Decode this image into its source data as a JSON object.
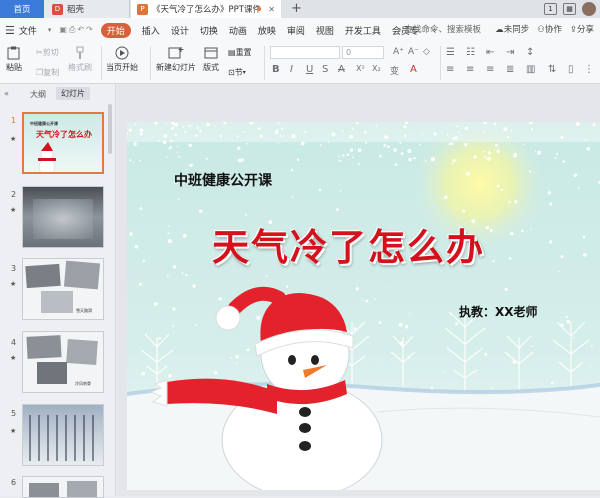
{
  "titlebar": {
    "home_tab": "首页",
    "tab2_label": "稻壳",
    "doc_tab_label": "《天气冷了怎么办》PPT课件",
    "add_tab": "+"
  },
  "menu": {
    "file": "文件",
    "items": [
      "开始",
      "插入",
      "设计",
      "切换",
      "动画",
      "放映",
      "审阅",
      "视图",
      "开发工具",
      "会员专"
    ],
    "search": "查找命令、搜索模板",
    "unsync": "未同步",
    "collab": "协作",
    "share": "分享"
  },
  "ribbon": {
    "paste": "粘贴",
    "cut": "剪切",
    "copy": "复制",
    "format_painter": "格式刷",
    "play_from_current": "当页开始",
    "new_slide": "新建幻灯片",
    "layout": "版式",
    "section": "节",
    "reset": "重置",
    "font_size_value": "0",
    "colors": {
      "accent": "#d9603a",
      "disabled": "#a6aab0"
    }
  },
  "panel": {
    "outline_tab": "大纲",
    "slides_tab": "幻灯片",
    "slide_numbers": [
      "1",
      "2",
      "3",
      "4",
      "5",
      "6"
    ],
    "thumb1_title": "天气冷了怎么办",
    "thumb1_sub": "中班健康公开课",
    "thumb3_caption": "雪天路滑",
    "thumb4_caption": "冷风刺骨"
  },
  "slide": {
    "subtitle": "中班健康公开课",
    "title": "天气冷了怎么办",
    "teacher": "执教：XX老师"
  }
}
